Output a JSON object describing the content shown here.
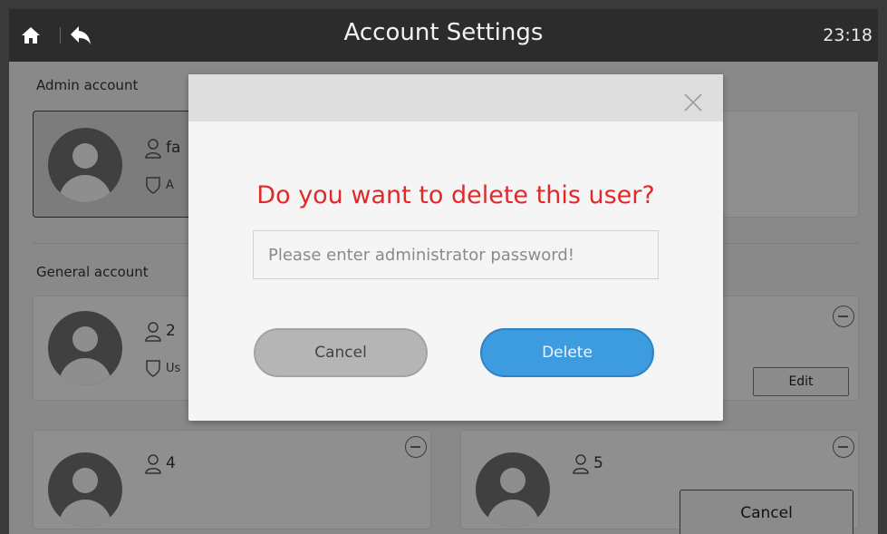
{
  "header": {
    "title": "Account Settings",
    "time": "23:18"
  },
  "admin": {
    "section_label": "Admin account",
    "name_partial": "fa",
    "role_partial": "A"
  },
  "general": {
    "section_label": "General account",
    "users": [
      {
        "name": "2",
        "role_partial": "Us",
        "edit_label": "Edit"
      },
      {
        "name": "4"
      },
      {
        "name": "5"
      }
    ]
  },
  "footer": {
    "cancel_label": "Cancel"
  },
  "dialog": {
    "question": "Do you want to delete this user?",
    "password_placeholder": "Please enter administrator password!",
    "cancel_label": "Cancel",
    "delete_label": "Delete",
    "question_color": "#e02a2a",
    "delete_color": "#3d9be0"
  }
}
